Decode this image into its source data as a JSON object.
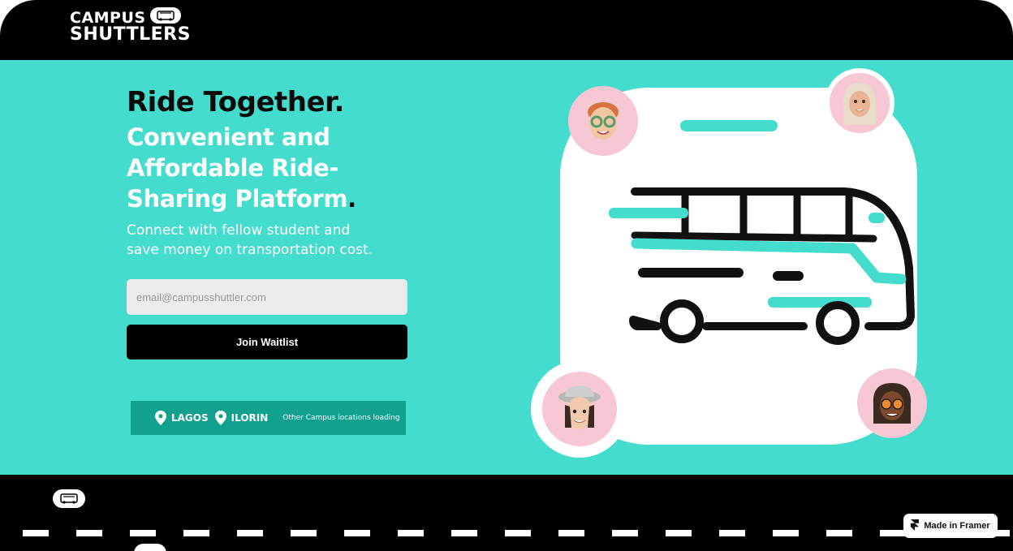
{
  "brand": {
    "line1": "CAMPUS",
    "line2": "SHUTTLERS"
  },
  "hero": {
    "title": "Ride Together.",
    "tagline": "Convenient and Affordable Ride-Sharing Platform",
    "tagline_dot": ".",
    "subtitle": "Connect with fellow student and save money on transportation cost.",
    "email_placeholder": "email@campusshuttler.com",
    "join_label": "Join Waitlist"
  },
  "locations": {
    "items": [
      "LAGOS",
      "ILORIN"
    ],
    "note": "Other Campus locations loading"
  },
  "footer": {
    "framer_label": "Made in Framer"
  },
  "colors": {
    "hero_bg": "#44dccd",
    "accent": "#12a08f",
    "dark": "#000000",
    "avatar_bg": "#f7c8d3"
  },
  "icons": [
    "shuttle-badge-icon",
    "pin-icon",
    "bus-illustration-icon",
    "framer-icon"
  ]
}
